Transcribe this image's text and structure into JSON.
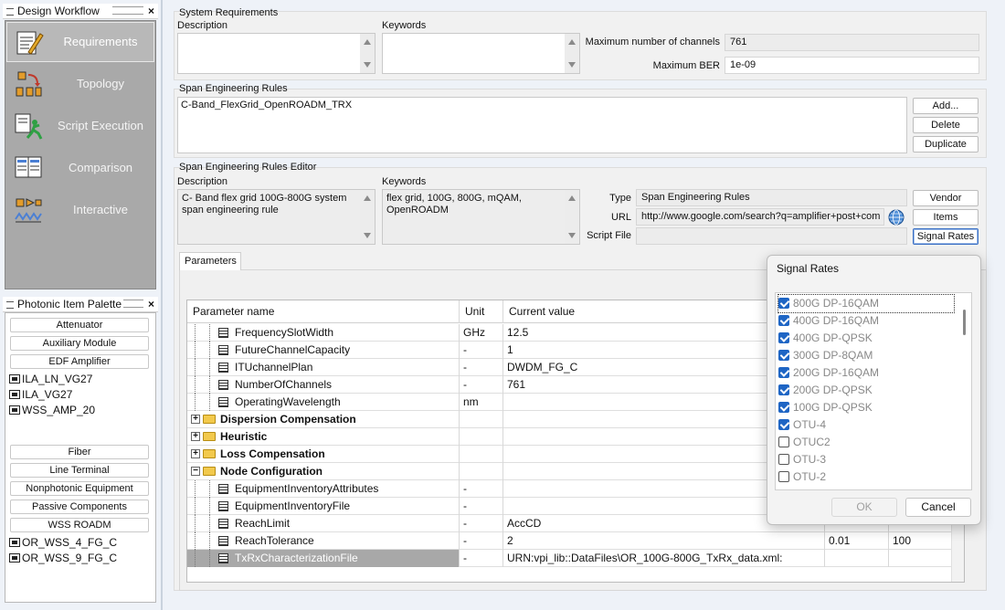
{
  "design_workflow": {
    "title": "Design Workflow",
    "items": [
      {
        "label": "Requirements",
        "icon": "requirements-icon"
      },
      {
        "label": "Topology",
        "icon": "topology-icon"
      },
      {
        "label": "Script Execution",
        "icon": "script-execution-icon"
      },
      {
        "label": "Comparison",
        "icon": "comparison-icon"
      },
      {
        "label": "Interactive",
        "icon": "interactive-icon"
      }
    ]
  },
  "palette": {
    "title": "Photonic Item Palette",
    "group1": [
      "Attenuator",
      "Auxiliary Module",
      "EDF Amplifier"
    ],
    "edf_items": [
      "ILA_LN_VG27",
      "ILA_VG27",
      "WSS_AMP_20"
    ],
    "group2": [
      "Fiber",
      "Line Terminal",
      "Nonphotonic Equipment",
      "Passive Components",
      "WSS ROADM"
    ],
    "wss_items": [
      "OR_WSS_4_FG_C",
      "OR_WSS_9_FG_C"
    ]
  },
  "system_requirements": {
    "title": "System Requirements",
    "description_label": "Description",
    "keywords_label": "Keywords",
    "description": "",
    "keywords": "",
    "max_channels_label": "Maximum number of channels",
    "max_channels": "761",
    "max_ber_label": "Maximum BER",
    "max_ber": "1e-09"
  },
  "span_rules": {
    "title": "Span Engineering Rules",
    "selected": "C-Band_FlexGrid_OpenROADM_TRX",
    "add": "Add...",
    "delete": "Delete",
    "duplicate": "Duplicate"
  },
  "editor": {
    "title": "Span Engineering Rules Editor",
    "description_label": "Description",
    "keywords_label": "Keywords",
    "description": "C- Band flex grid 100G-800G system span engineering rule",
    "keywords": "flex grid, 100G, 800G, mQAM, OpenROADM",
    "type_label": "Type",
    "type": "Span Engineering Rules",
    "url_label": "URL",
    "url": "http://www.google.com/search?q=amplifier+post+com",
    "script_label": "Script File",
    "script": "",
    "vendor": "Vendor",
    "items": "Items",
    "signal_rates": "Signal Rates"
  },
  "parameters": {
    "tab": "Parameters",
    "headers": {
      "name": "Parameter name",
      "unit": "Unit",
      "value": "Current value"
    },
    "rows": [
      {
        "kind": "leaf",
        "name": "FrequencySlotWidth",
        "unit": "GHz",
        "value": "12.5",
        "min": "",
        "max": ""
      },
      {
        "kind": "leaf",
        "name": "FutureChannelCapacity",
        "unit": "-",
        "value": "1",
        "min": "",
        "max": ""
      },
      {
        "kind": "leaf",
        "name": "ITUchannelPlan",
        "unit": "-",
        "value": "DWDM_FG_C",
        "min": "",
        "max": ""
      },
      {
        "kind": "leaf",
        "name": "NumberOfChannels",
        "unit": "-",
        "value": "761",
        "min": "",
        "max": ""
      },
      {
        "kind": "leaf",
        "name": "OperatingWavelength",
        "unit": "nm",
        "value": "",
        "min": "",
        "max": ""
      },
      {
        "kind": "folder",
        "name": "Dispersion Compensation",
        "expander": "+"
      },
      {
        "kind": "folder",
        "name": "Heuristic",
        "expander": "+"
      },
      {
        "kind": "folder",
        "name": "Loss Compensation",
        "expander": "+"
      },
      {
        "kind": "folder-open",
        "name": "Node Configuration",
        "expander": "−"
      },
      {
        "kind": "leaf",
        "name": "EquipmentInventoryAttributes",
        "unit": "-",
        "value": "",
        "min": "",
        "max": ""
      },
      {
        "kind": "leaf",
        "name": "EquipmentInventoryFile",
        "unit": "-",
        "value": "",
        "min": "",
        "max": ""
      },
      {
        "kind": "leaf",
        "name": "ReachLimit",
        "unit": "-",
        "value": "AccCD",
        "min": "",
        "max": ""
      },
      {
        "kind": "leaf",
        "name": "ReachTolerance",
        "unit": "-",
        "value": "2",
        "min": "0.01",
        "max": "100"
      },
      {
        "kind": "leaf",
        "name": "TxRxCharacterizationFile",
        "unit": "-",
        "value": "URN:vpi_lib::DataFiles\\OR_100G-800G_TxRx_data.xml:",
        "min": "",
        "max": "",
        "selected": true
      }
    ]
  },
  "signal_rates_dialog": {
    "title": "Signal Rates",
    "options": [
      {
        "label": "800G DP-16QAM",
        "checked": true
      },
      {
        "label": "400G DP-16QAM",
        "checked": true
      },
      {
        "label": "400G DP-QPSK",
        "checked": true
      },
      {
        "label": "300G DP-8QAM",
        "checked": true
      },
      {
        "label": "200G DP-16QAM",
        "checked": true
      },
      {
        "label": "200G DP-QPSK",
        "checked": true
      },
      {
        "label": "100G DP-QPSK",
        "checked": true
      },
      {
        "label": "OTU-4",
        "checked": true
      },
      {
        "label": "OTUC2",
        "checked": false
      },
      {
        "label": "OTU-3",
        "checked": false
      },
      {
        "label": "OTU-2",
        "checked": false
      }
    ],
    "ok": "OK",
    "cancel": "Cancel"
  }
}
